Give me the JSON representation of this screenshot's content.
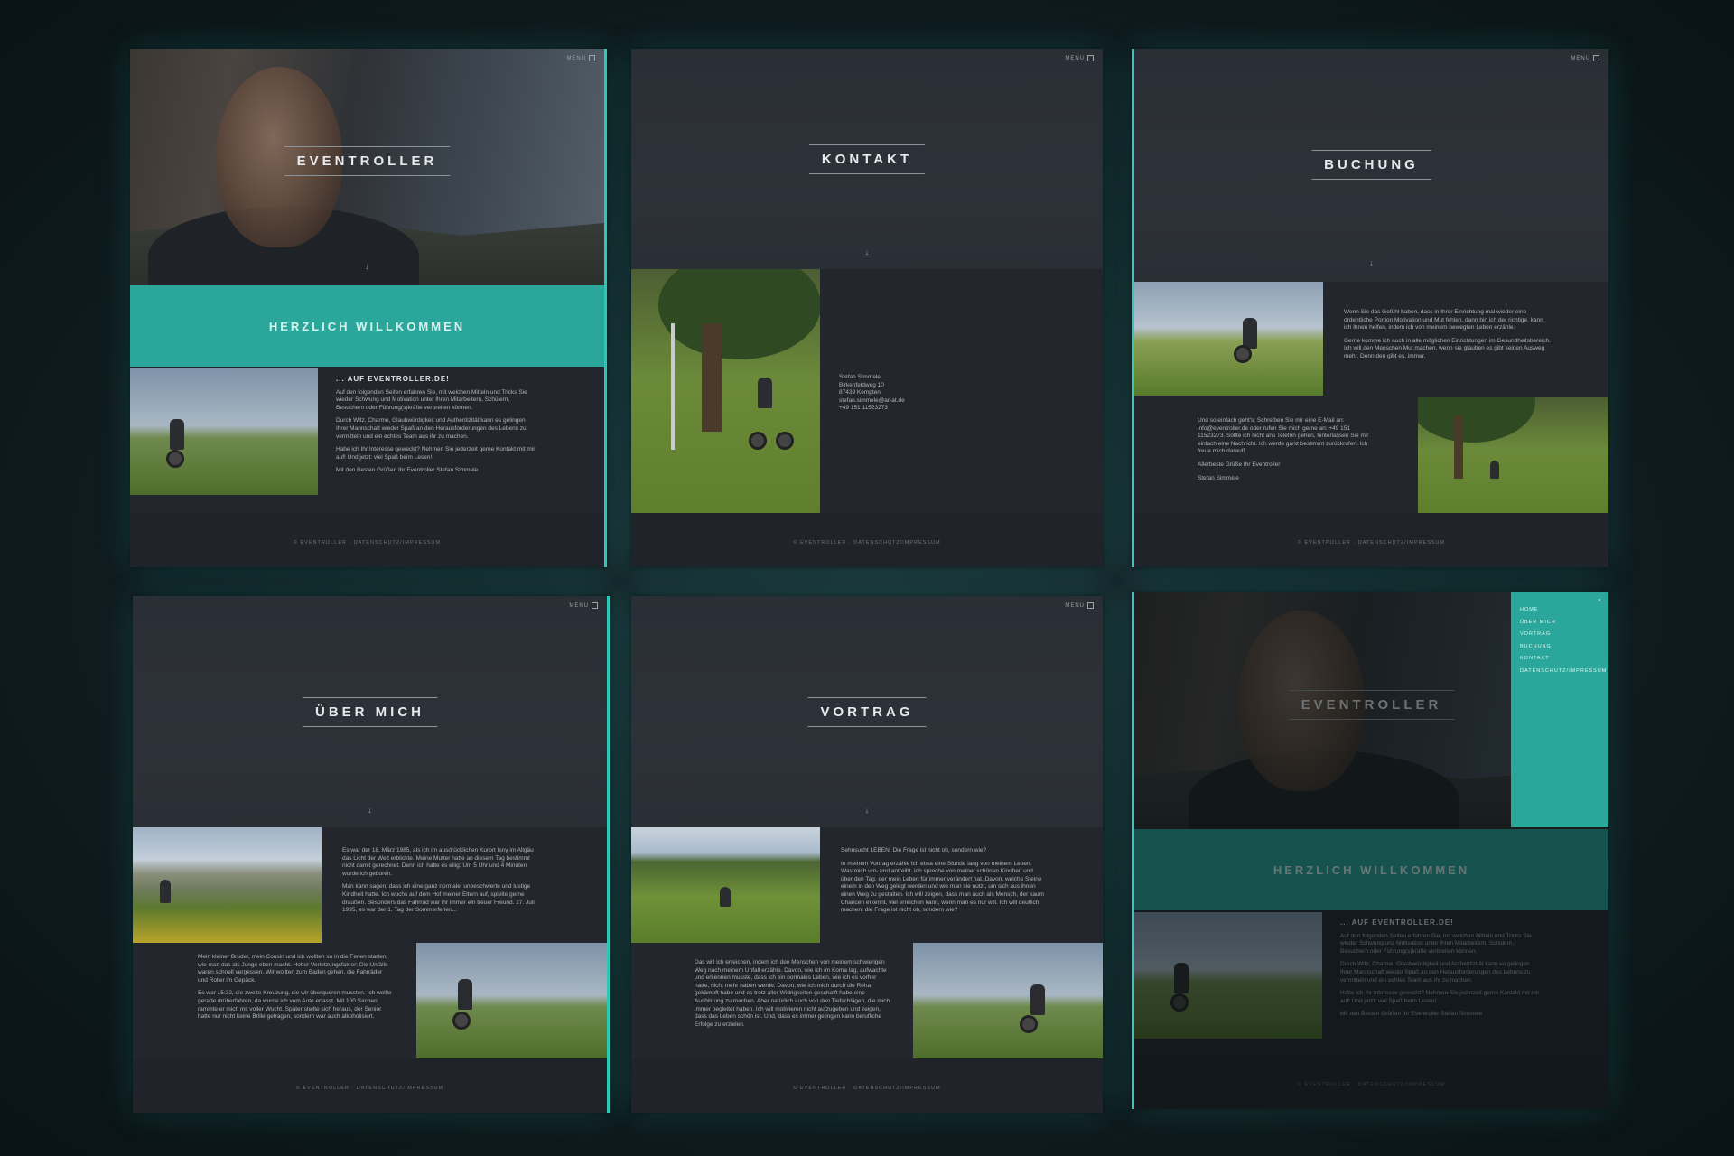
{
  "common": {
    "menu_label": "MENU",
    "footer_text": "© EVENTROLLER  ·  DATENSCHUTZ/IMPRESSUM"
  },
  "home": {
    "title": "EVENTROLLER",
    "welcome": "HERZLICH WILLKOMMEN",
    "intro_heading": "... AUF EVENTROLLER.DE!",
    "intro_p1": "Auf den folgenden Seiten erfahren Sie, mit welchen Mitteln und Tricks Sie wieder Schwung und Motivation unter Ihren Mitarbeitern, Schülern, Besuchern oder Führung(s)kräfte verbreiten können.",
    "intro_p2": "Durch Witz, Charme, Glaubwürdigkeit und Authentizität kann es gelingen Ihrer Mannschaft wieder Spaß an den Herausforderungen des Lebens zu vermitteln und ein echtes Team aus ihr zu machen.",
    "intro_p3": "Habe ich Ihr Interesse geweckt? Nehmen Sie jederzeit gerne Kontakt mit mir auf! Und jetzt: viel Spaß beim Lesen!",
    "intro_p4": "Mit den Besten Grüßen Ihr Eventroller Stefan Simmele"
  },
  "kontakt": {
    "title": "KONTAKT",
    "address_name": "Stefan Simmele",
    "address_street": "Birkenfeldweg 10",
    "address_city": "87439 Kempten",
    "address_email": "stefan.simmele@ar-at.de",
    "address_phone": "+49 151 11523273"
  },
  "buchung": {
    "title": "BUCHUNG",
    "p1": "Wenn Sie das Gefühl haben, dass in Ihrer Einrichtung mal wieder eine ordentliche Portion Motivation und Mut fehlen, dann bin ich der richtige, kann ich Ihnen helfen, indem ich von meinem bewegten Leben erzähle.",
    "p2": "Gerne komme ich auch in alle möglichen Einrichtungen im Gesundheitsbereich. Ich will den Menschen Mut machen, wenn sie glauben es gibt keinen Ausweg mehr. Denn den gibt es, immer.",
    "p3": "Und so einfach geht's: Schreiben Sie mir eine E-Mail an: info@eventroller.de oder rufen Sie mich gerne an: +49 151 11523273. Sollte ich nicht ans Telefon gehen, hinterlassen Sie mir einfach eine Nachricht. Ich werde ganz bestimmt zurückrufen. Ich freue mich darauf!",
    "p4": "Allerbeste Grüße Ihr Eventroller",
    "p5": "Stefan Simmele"
  },
  "ueber": {
    "title": "ÜBER MICH",
    "p1": "Es war der 18. März 1985, als ich im ausdrücklichen Kurort Isny im Allgäu das Licht der Welt erblickte. Meine Mutter hatte an diesem Tag bestimmt nicht damit gerechnet. Denn ich hatte es eilig: Um 5 Uhr und 4 Minuten wurde ich geboren.",
    "p2": "Man kann sagen, dass ich eine ganz normale, unbeschwerte und lustige Kindheit hatte. Ich wuchs auf dem Hof meiner Eltern auf, spielte gerne draußen. Besonders das Fahrrad war ihr immer ein treuer Freund. 27. Juli 1995, es war der 1. Tag der Sommerferien...",
    "p3": "Mein kleiner Bruder, mein Cousin und ich wollten so in die Ferien starten, wie man das als Junge eben macht. Hoher Verletzungsfaktor: Die Unfälle waren schnell vergessen. Wir wollten zum Baden gehen, die Fahrräder und Roller im Gepäck.",
    "p4": "Es war 15:32, die zweite Kreuzung, die wir überqueren mussten. Ich wollte gerade drüberfahren, da wurde ich vom Auto erfasst. Mit 100 Sachen rammte er mich mit voller Wucht. Später stellte sich heraus, der Senior hatte nur nicht keine Brille getragen, sondern war auch alkoholisiert."
  },
  "vortrag": {
    "title": "VORTRAG",
    "p1": "Sehnsucht LEBEN! Die Frage ist nicht ob, sondern wie?",
    "p2": "In meinem Vortrag erzähle ich etwa eine Stunde lang von meinem Leben. Was mich um- und antreibt. Ich spreche von meiner schönen Kindheit und über den Tag, der mein Leben für immer verändert hat. Davon, welche Steine einem in den Weg gelegt werden und wie man sie nutzt, um sich aus ihnen einen Weg zu gestalten. Ich will zeigen, dass man auch als Mensch, der kaum Chancen erkennt, viel erreichen kann, wenn man es nur will. Ich will deutlich machen: die Frage ist nicht ob, sondern wie?",
    "p3": "Das will ich erreichen, indem ich den Menschen von meinem schwierigen Weg nach meinem Unfall erzähle. Davon, wie ich im Koma lag, aufwachte und erkennen musste, dass ich ein normales Leben, wie ich es vorher hatte, nicht mehr haben werde. Davon, wie ich mich durch die Reha gekämpft habe und es trotz aller Widrigkeiten geschafft habe eine Ausbildung zu machen. Aber natürlich auch von den Tiefschlägen, die mich immer begleitet haben. Ich will motivieren nicht aufzugeben und zeigen, dass das Leben schön ist. Und, dass es immer gelingen kann berufliche Erfolge zu erzielen."
  },
  "menu_overlay": {
    "close": "×",
    "items": [
      "HOME",
      "ÜBER MICH",
      "VORTRAG",
      "BUCHUNG",
      "KONTAKT",
      "DATENSCHUTZ/IMPRESSUM"
    ]
  }
}
